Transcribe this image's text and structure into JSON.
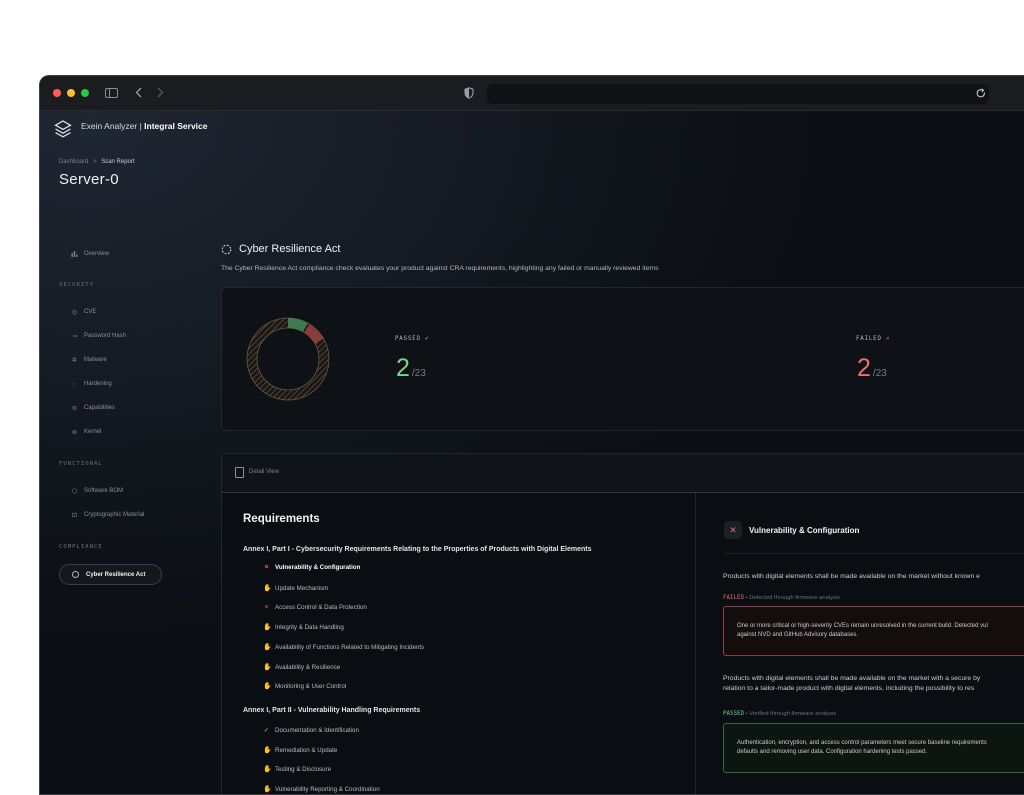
{
  "brand": {
    "name": "Exein Analyzer",
    "separator": " | ",
    "service": "Integral Service"
  },
  "breadcrumb": {
    "parent": "Dashboard",
    "separator": ">",
    "current": "Scan Report"
  },
  "page_title": "Server-0",
  "sidebar": {
    "overview": "Overview",
    "sections": [
      {
        "heading": "SECURITY",
        "items": [
          "CVE",
          "Password Hash",
          "Malware",
          "Hardening",
          "Capabilities",
          "Kernel"
        ]
      },
      {
        "heading": "FUNCTIONAL",
        "items": [
          "Software BOM",
          "Cryptographic Material"
        ]
      },
      {
        "heading": "COMPLIANCE",
        "items": [
          "Cyber Resilience Act"
        ]
      }
    ]
  },
  "cra": {
    "title": "Cyber Resilience Act",
    "description": "The Cyber Resilience Act compliance check evaluates your product against CRA requirements, highlighting any failed or manually reviewed items"
  },
  "summary": {
    "passed": {
      "label": "PASSED",
      "value": "2",
      "total": "/23",
      "color": "#7ed28e"
    },
    "failed": {
      "label": "FAILED",
      "value": "2",
      "total": "/23",
      "color": "#ef6f6f"
    },
    "donut": {
      "passed": 2,
      "failed": 2,
      "total": 23,
      "passed_color": "#3f7a4f",
      "failed_color": "#8a3b3b"
    }
  },
  "detail_view": {
    "label": "Detail View"
  },
  "requirements": {
    "title": "Requirements",
    "groups": [
      {
        "title": "Annex I, Part I - Cybersecurity Requirements Relating to the Properties of Products with Digital Elements",
        "items": [
          {
            "label": "Vulnerability & Configuration",
            "status": "failed",
            "icon": "×"
          },
          {
            "label": "Update Mechanism",
            "status": "review",
            "icon": "✋"
          },
          {
            "label": "Access Control & Data Protection",
            "status": "failed",
            "icon": "×"
          },
          {
            "label": "Integrity & Data Handling",
            "status": "review",
            "icon": "✋"
          },
          {
            "label": "Availability of Functions Related to Mitigating Incidents",
            "status": "review",
            "icon": "✋"
          },
          {
            "label": "Availability & Resilience",
            "status": "review",
            "icon": "✋"
          },
          {
            "label": "Monitoring & User Control",
            "status": "review",
            "icon": "✋"
          }
        ]
      },
      {
        "title": "Annex I, Part II - Vulnerability Handling Requirements",
        "items": [
          {
            "label": "Documentation & Identification",
            "status": "passed",
            "icon": "✓"
          },
          {
            "label": "Remediation & Update",
            "status": "review",
            "icon": "✋"
          },
          {
            "label": "Testing & Disclosure",
            "status": "review",
            "icon": "✋"
          },
          {
            "label": "Vulnerability Reporting & Coordination",
            "status": "review",
            "icon": "✋"
          }
        ]
      }
    ]
  },
  "detail": {
    "title": "Vulnerability & Configuration",
    "checks": [
      {
        "text": "Products with digital elements shall be made available on the market without known e",
        "status": "FAILED",
        "note": " • Detected through firmware analysis",
        "box_lines": [
          "One or more critical or high-severity CVEs remain unresolved in the current build. Detected vul",
          "against NVD and GitHub Advisory databases."
        ]
      },
      {
        "text_lines": [
          "Products with digital elements shall be made available on the market with a secure by",
          "relation to a tailor-made product with digital elements, including the possibility to res"
        ],
        "status": "PASSED",
        "note": " • Verified through firmware analysis",
        "box_lines": [
          "Authentication, encryption, and access control parameters meet secure baseline requirements",
          "defaults and removing user data. Configuration hardening tests passed."
        ]
      }
    ]
  }
}
